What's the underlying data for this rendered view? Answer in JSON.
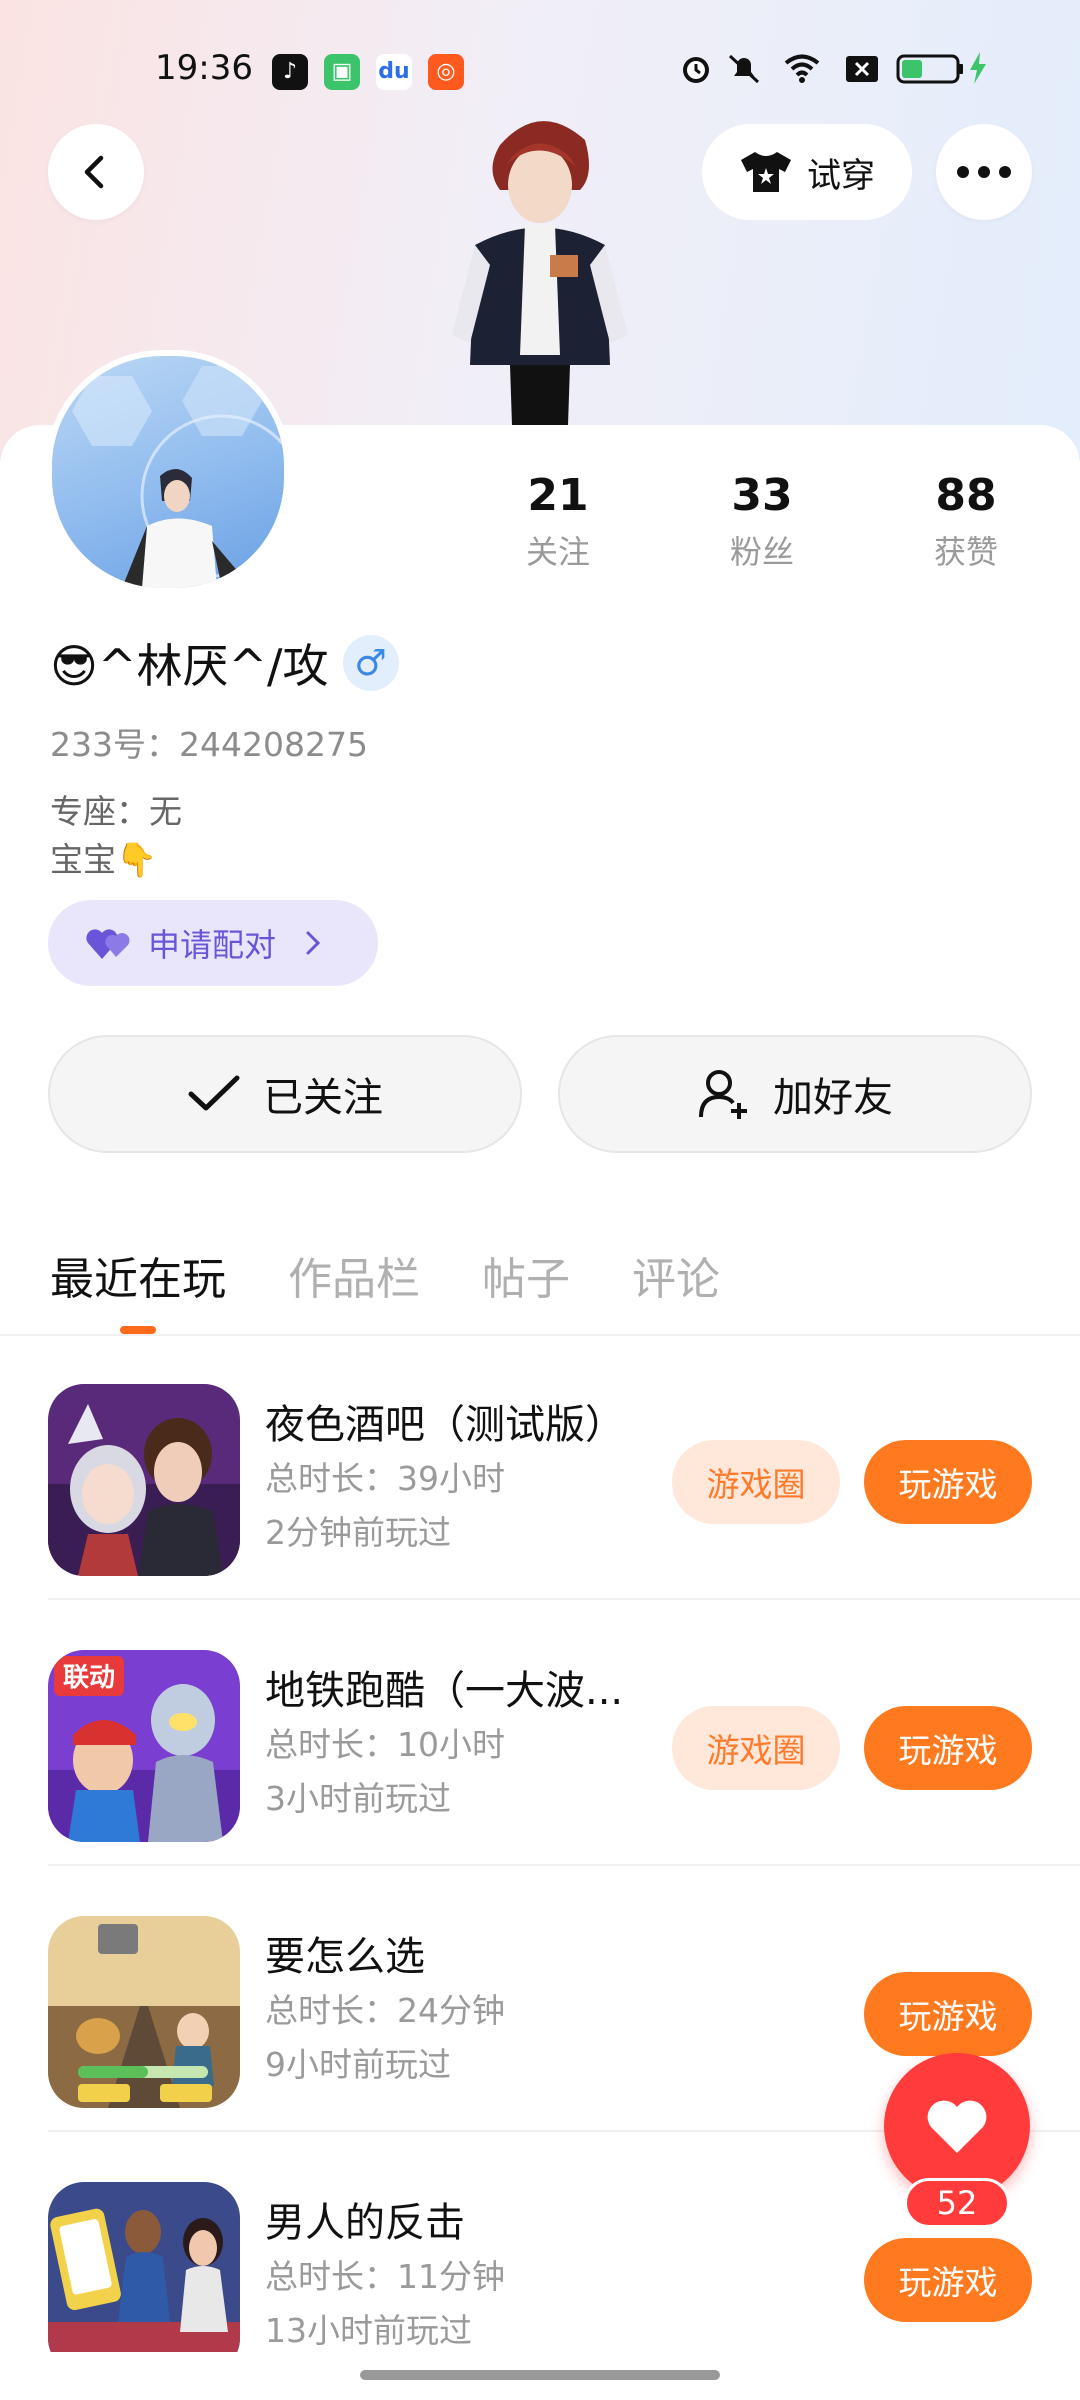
{
  "status_bar": {
    "time": "19:36",
    "app_icons": [
      "tiktok-icon",
      "wechat-mini-icon",
      "baidu-icon",
      "kuaishou-icon"
    ],
    "right_icons": [
      "alarm-icon",
      "mute-icon",
      "wifi-icon",
      "sim-off-icon",
      "battery-icon",
      "charging-icon"
    ]
  },
  "topbar": {
    "try_on_label": "试穿"
  },
  "stats": [
    {
      "value": "21",
      "label": "关注"
    },
    {
      "value": "33",
      "label": "粉丝"
    },
    {
      "value": "88",
      "label": "获赞"
    }
  ],
  "profile": {
    "name": "😎^林厌^/攻",
    "gender_symbol": "♂",
    "id_line": "233号：244208275",
    "seat_line": "专座：无",
    "bio": "宝宝👇",
    "pair_label": "申请配对"
  },
  "actions": {
    "following_label": "已关注",
    "add_friend_label": "加好友"
  },
  "tabs": [
    "最近在玩",
    "作品栏",
    "帖子",
    "评论"
  ],
  "games": [
    {
      "title": "夜色酒吧（测试版）",
      "duration": "总时长：39小时",
      "last_played": "2分钟前玩过",
      "circle_label": "游戏圈",
      "play_label": "玩游戏"
    },
    {
      "title": "地铁跑酷（一大波...",
      "duration": "总时长：10小时",
      "last_played": "3小时前玩过",
      "circle_label": "游戏圈",
      "play_label": "玩游戏"
    },
    {
      "title": "要怎么选",
      "duration": "总时长：24分钟",
      "last_played": "9小时前玩过",
      "play_label": "玩游戏"
    },
    {
      "title": "男人的反击",
      "duration": "总时长：11分钟",
      "last_played": "13小时前玩过",
      "play_label": "玩游戏"
    }
  ],
  "game_icon_texts": {
    "subway_badge": "联动"
  },
  "like_fab": {
    "count": "52"
  },
  "colors": {
    "accent": "#ff7a1e",
    "like_red": "#ff3b3b",
    "pair_purple": "#6a55d8"
  }
}
